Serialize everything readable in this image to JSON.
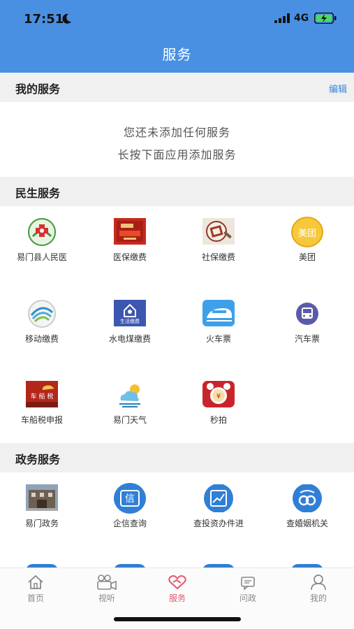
{
  "status_bar": {
    "time": "17:51",
    "network": "4G"
  },
  "header": {
    "title": "服务"
  },
  "my_services": {
    "title": "我的服务",
    "edit_label": "编辑",
    "empty_line1": "您还未添加任何服务",
    "empty_line2": "长按下面应用添加服务"
  },
  "livelihood": {
    "title": "民生服务",
    "items": [
      {
        "label": "易门县人民医",
        "icon": "hospital-logo-icon"
      },
      {
        "label": "医保缴费",
        "icon": "medical-insurance-icon"
      },
      {
        "label": "社保缴费",
        "icon": "social-security-icon"
      },
      {
        "label": "美团",
        "icon": "meituan-icon",
        "icon_text": "美团"
      },
      {
        "label": "移动缴费",
        "icon": "china-mobile-icon"
      },
      {
        "label": "水电煤缴费",
        "icon": "utilities-icon",
        "icon_text": "生活缴费"
      },
      {
        "label": "火车票",
        "icon": "train-icon"
      },
      {
        "label": "汽车票",
        "icon": "bus-icon"
      },
      {
        "label": "车船税申报",
        "icon": "vehicle-tax-icon",
        "icon_text": "车 船 税"
      },
      {
        "label": "易门天气",
        "icon": "weather-icon"
      },
      {
        "label": "秒拍",
        "icon": "alarm-clock-icon"
      }
    ]
  },
  "government": {
    "title": "政务服务",
    "items": [
      {
        "label": "易门政务",
        "icon": "government-building-icon"
      },
      {
        "label": "企信查询",
        "icon": "credit-icon",
        "icon_text": "信"
      },
      {
        "label": "查投资办件进",
        "icon": "investment-icon"
      },
      {
        "label": "查婚姻机关",
        "icon": "marriage-icon"
      }
    ]
  },
  "tabbar": {
    "items": [
      {
        "label": "首页",
        "icon": "home-icon"
      },
      {
        "label": "视听",
        "icon": "video-camera-icon"
      },
      {
        "label": "服务",
        "icon": "service-heart-icon"
      },
      {
        "label": "问政",
        "icon": "message-icon"
      },
      {
        "label": "我的",
        "icon": "person-icon"
      }
    ],
    "active_index": 2
  },
  "colors": {
    "header": "#4a90e2",
    "active_tab": "#e8566b",
    "edit_link": "#3a86d8",
    "section_bg": "#f0f0f0"
  }
}
